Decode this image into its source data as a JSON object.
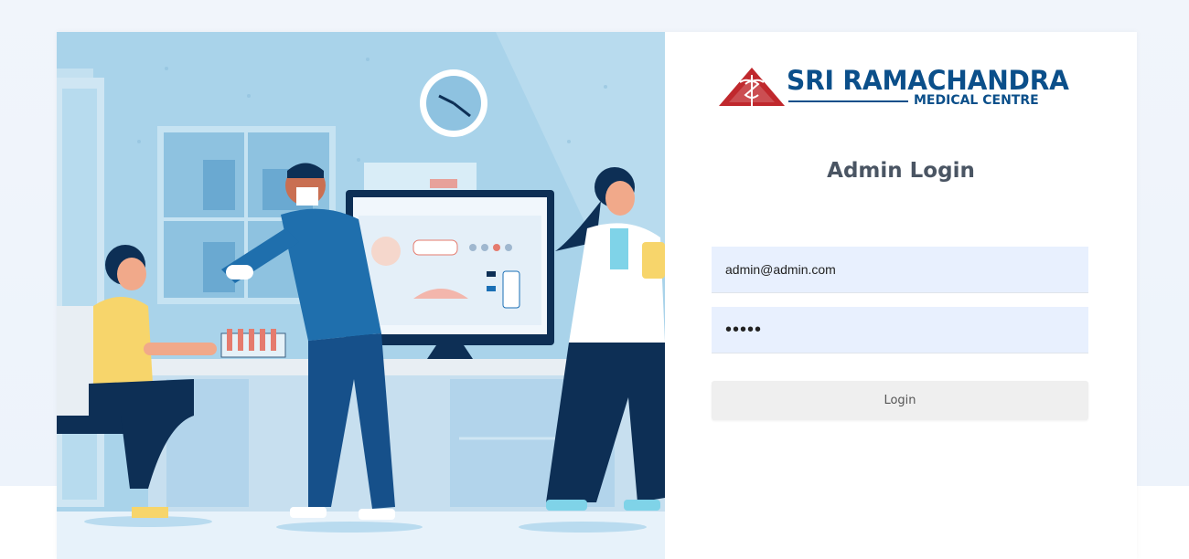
{
  "brand": {
    "name": "SRI RAMACHANDRA",
    "subtitle": "MEDICAL CENTRE",
    "color": "#0b4f8a",
    "emblem_color": "#c0282d"
  },
  "login": {
    "heading": "Admin Login",
    "email_value": "admin@admin.com",
    "password_mask": "•••••",
    "button_label": "Login"
  },
  "colors": {
    "input_bg": "#e8f0fe",
    "button_bg": "#efefef"
  }
}
